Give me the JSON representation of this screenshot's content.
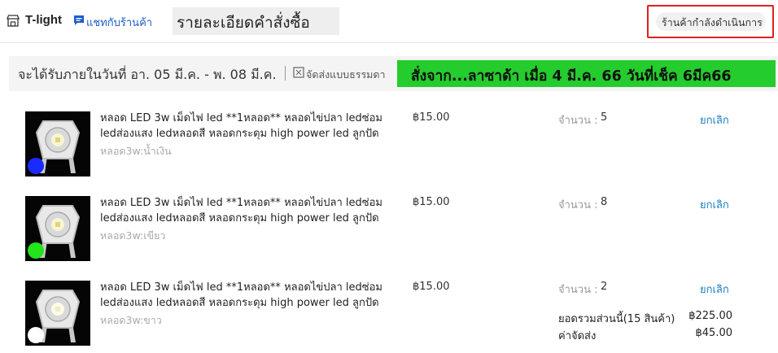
{
  "header": {
    "shop_name": "T-light",
    "chat_label": "แชทกับร้านค้า",
    "page_title": "รายละเอียดคำสั่งซื้อ",
    "status": "ร้านค้ากำลังดำเนินการ"
  },
  "delivery": {
    "estimate": "จะได้รับภายในวันที่ อา. 05 มี.ค. - พ. 08 มี.ค.",
    "shipping": "จัดส่งแบบธรรมดา",
    "note": "สั่งจาก...ลาซาด้า เมื่อ 4 มี.ค. 66 วันที่เช็ค 6มีค66"
  },
  "qty_label": "จำนวน :",
  "cancel_label": "ยกเลิก",
  "items": [
    {
      "name": "หลอด LED 3w เม็ดไฟ led **1หลอด** หลอดไข่ปลา ledซ่อม ledส่องแสง ledหลอดสี หลอดกระดุม high power led ลูกปัด",
      "variant": "หลอด3w:น้ำเงิน",
      "price": "฿15.00",
      "qty": "5",
      "color": "#1a2bff"
    },
    {
      "name": "หลอด LED 3w เม็ดไฟ led **1หลอด** หลอดไข่ปลา ledซ่อม ledส่องแสง ledหลอดสี หลอดกระดุม high power led ลูกปัด",
      "variant": "หลอด3w:เขียว",
      "price": "฿15.00",
      "qty": "8",
      "color": "#22e51b"
    },
    {
      "name": "หลอด LED 3w เม็ดไฟ led **1หลอด** หลอดไข่ปลา ledซ่อม ledส่องแสง ledหลอดสี หลอดกระดุม high power led ลูกปัด",
      "variant": "หลอด3w:ขาว",
      "price": "฿15.00",
      "qty": "2",
      "color": "#ffffff"
    }
  ],
  "summary": {
    "subtotal_label": "ยอดรวมส่วนนี้(15 สินค้า)",
    "subtotal": "฿225.00",
    "shipping_label": "ค่าจัดส่ง",
    "shipping_fee": "฿45.00"
  }
}
